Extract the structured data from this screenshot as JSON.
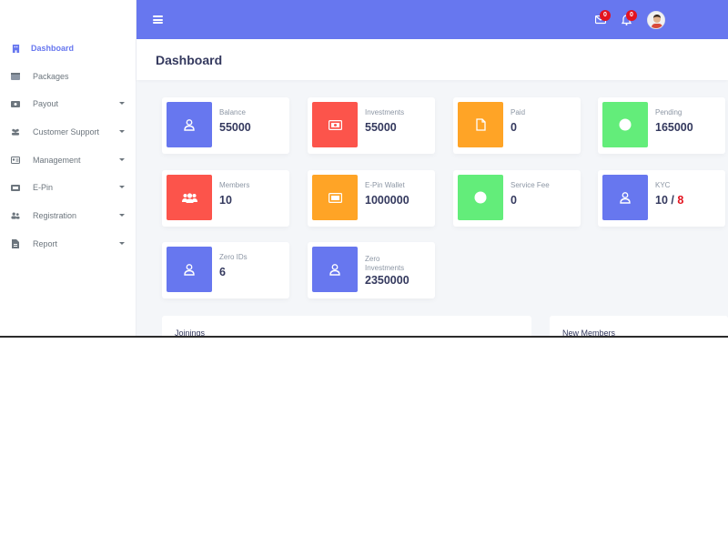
{
  "sidebar": {
    "items": [
      {
        "label": "Dashboard",
        "active": true,
        "icon": "building-icon"
      },
      {
        "label": "Packages",
        "icon": "box-icon"
      },
      {
        "label": "Payout",
        "icon": "money-icon",
        "dropdown": true
      },
      {
        "label": "Customer Support",
        "icon": "users-icon",
        "dropdown": true
      },
      {
        "label": "Management",
        "icon": "id-card-icon",
        "dropdown": true
      },
      {
        "label": "E-Pin",
        "icon": "ticket-icon",
        "dropdown": true
      },
      {
        "label": "Registration",
        "icon": "user-plus-icon",
        "dropdown": true
      },
      {
        "label": "Report",
        "icon": "file-icon",
        "dropdown": true
      }
    ]
  },
  "topbar": {
    "menu_icon": "hamburger-icon",
    "mail_badge": "0",
    "bell_badge": "0"
  },
  "header": {
    "title": "Dashboard"
  },
  "cards": [
    {
      "label": "Balance",
      "value": "55000",
      "color": "#6777ef",
      "icon": "user-icon"
    },
    {
      "label": "Investments",
      "value": "55000",
      "color": "#fc544b",
      "icon": "money-bill-icon"
    },
    {
      "label": "Paid",
      "value": "0",
      "color": "#ffa426",
      "icon": "file-icon"
    },
    {
      "label": "Pending",
      "value": "165000",
      "color": "#63ed7a",
      "icon": "circle-icon"
    },
    {
      "label": "Members",
      "value": "10",
      "color": "#fc544b",
      "icon": "users-icon"
    },
    {
      "label": "E-Pin Wallet",
      "value": "1000000",
      "color": "#ffa426",
      "icon": "ticket-icon"
    },
    {
      "label": "Service Fee",
      "value": "0",
      "color": "#63ed7a",
      "icon": "circle-icon"
    },
    {
      "label": "KYC",
      "value_main": "10 / ",
      "value_red": "8",
      "color": "#6777ef",
      "icon": "user-icon"
    },
    {
      "label": "Zero IDs",
      "value": "6",
      "color": "#6777ef",
      "icon": "user-icon"
    },
    {
      "label_line1": "Zero",
      "label_line2": "Investments",
      "value": "2350000",
      "color": "#6777ef",
      "icon": "user-icon"
    }
  ],
  "panels": {
    "joinings": "Joinings",
    "new_members": "New Members"
  }
}
